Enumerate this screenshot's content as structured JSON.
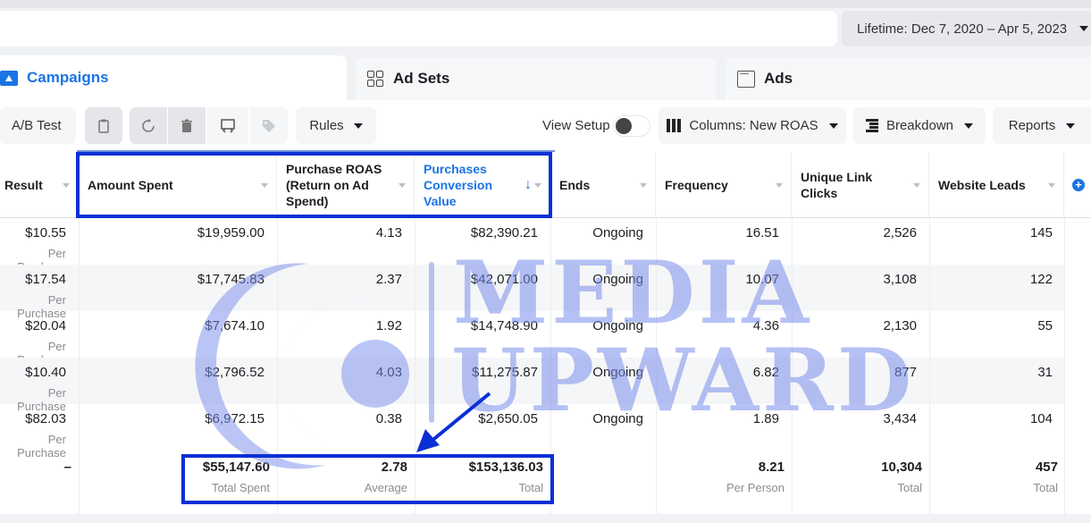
{
  "header": {
    "date_range": "Lifetime: Dec 7, 2020 – Apr 5, 2023"
  },
  "tabs": [
    {
      "label": "Campaigns",
      "icon": "folder-icon",
      "active": true
    },
    {
      "label": "Ad Sets",
      "icon": "grid-icon",
      "active": false
    },
    {
      "label": "Ads",
      "icon": "ad-icon",
      "active": false
    }
  ],
  "toolbar": {
    "ab_test": "A/B Test",
    "rules": "Rules",
    "view_setup": "View Setup",
    "view_setup_on": false,
    "columns": "Columns: New ROAS",
    "breakdown": "Breakdown",
    "reports": "Reports"
  },
  "table": {
    "columns": [
      "Result",
      "Amount Spent",
      "Purchase ROAS (Return on Ad Spend)",
      "Purchases Conversion Value",
      "Ends",
      "Frequency",
      "Unique Link Clicks",
      "Website Leads"
    ],
    "sorted_column": "Purchases Conversion Value",
    "rows": [
      {
        "result": "$10.55",
        "result_sub": "Per Purchase",
        "amount_spent": "$19,959.00",
        "roas": "4.13",
        "conv_value": "$82,390.21",
        "ends": "Ongoing",
        "frequency": "16.51",
        "unique_clicks": "2,526",
        "leads": "145"
      },
      {
        "result": "$17.54",
        "result_sub": "Per Purchase",
        "amount_spent": "$17,745.83",
        "roas": "2.37",
        "conv_value": "$42,071.00",
        "ends": "Ongoing",
        "frequency": "10.07",
        "unique_clicks": "3,108",
        "leads": "122"
      },
      {
        "result": "$20.04",
        "result_sub": "Per Purchase",
        "amount_spent": "$7,674.10",
        "roas": "1.92",
        "conv_value": "$14,748.90",
        "ends": "Ongoing",
        "frequency": "4.36",
        "unique_clicks": "2,130",
        "leads": "55"
      },
      {
        "result": "$10.40",
        "result_sub": "Per Purchase",
        "amount_spent": "$2,796.52",
        "roas": "4.03",
        "conv_value": "$11,275.87",
        "ends": "Ongoing",
        "frequency": "6.82",
        "unique_clicks": "877",
        "leads": "31"
      },
      {
        "result": "$82.03",
        "result_sub": "Per Purchase",
        "amount_spent": "$6,972.15",
        "roas": "0.38",
        "conv_value": "$2,650.05",
        "ends": "Ongoing",
        "frequency": "1.89",
        "unique_clicks": "3,434",
        "leads": "104"
      }
    ],
    "summary": {
      "result": "–",
      "amount_spent": "$55,147.60",
      "amount_spent_sub": "Total Spent",
      "roas": "2.78",
      "roas_sub": "Average",
      "conv_value": "$153,136.03",
      "conv_value_sub": "Total",
      "frequency": "8.21",
      "frequency_sub": "Per Person",
      "unique_clicks": "10,304",
      "unique_clicks_sub": "Total",
      "leads": "457",
      "leads_sub": "Total"
    }
  },
  "watermark": {
    "line1": "MEDIA",
    "line2": "UPWARD"
  },
  "colors": {
    "accent": "#1b74e4",
    "highlight": "#0a2fd6",
    "watermark": "#8c9cf0"
  }
}
